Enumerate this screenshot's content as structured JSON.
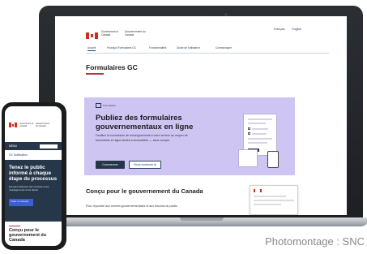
{
  "laptop": {
    "gov_en": "Government of Canada",
    "gov_fr": "Gouvernement du Canada",
    "lang_links": [
      "Français",
      "English"
    ],
    "nav": [
      "Accueil",
      "Pourquoi Formulaires GC",
      "Fonctionnalités",
      "Guide de l'utilisateur",
      "Communiquer"
    ],
    "page_title": "Formulaires GC",
    "hero": {
      "tag": "Formulaires",
      "heading": "Publiez des formulaires gouvernementaux en ligne",
      "paragraph": "Facilitez la soumission de renseignements à votre service au moyen de formulaires en ligne faciles à accessibles — sans compte.",
      "primary_button": "Commencer",
      "secondary_button": "Nous contacter ⧉"
    },
    "section": {
      "heading": "Conçu pour le gouvernement du Canada",
      "paragraph": "Pour répondre aux normes gouvernementales et aux besoins du public."
    }
  },
  "phone": {
    "gov_en": "Government of Canada",
    "gov_fr": "Gouvernement du Canada",
    "menu_label": "MENU",
    "breadcrumb": "GC Notification",
    "hero_heading": "Tenez le public informé à chaque étape du processus",
    "hero_paragraph": "Envoyez facilement des courriels et des messages texte à vos clients.",
    "hero_button": "Créer un compte",
    "section_heading": "Conçu pour le gouvernement du Canada"
  },
  "caption": "Photomontage : SNC",
  "colors": {
    "hero_lavender": "#cfc5f3",
    "gc_navy": "#26374a",
    "flag_red": "#d52b1e",
    "accent_red": "#af3c43"
  }
}
